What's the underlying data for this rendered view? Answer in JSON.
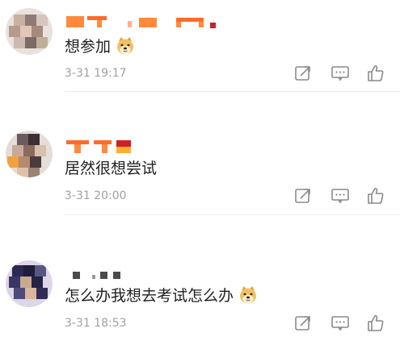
{
  "comments": [
    {
      "username": "",
      "text": "想参加",
      "emoji": "doge-emoji",
      "timestamp": "3-31 19:17"
    },
    {
      "username": "",
      "text": "居然很想尝试",
      "emoji": "",
      "timestamp": "3-31 20:00"
    },
    {
      "username": "",
      "text": "怎么办我想去考试怎么办",
      "emoji": "doge-emoji",
      "timestamp": "3-31 18:53"
    }
  ],
  "actions": {
    "repost_icon": "repost-icon",
    "comment_icon": "comment-icon",
    "like_icon": "thumbs-up-icon"
  },
  "colors": {
    "username_orange": "#ff8a3d",
    "username_red": "#d21f26",
    "timestamp_gray": "#a0a0a0",
    "icon_gray": "#8a8a8a",
    "divider": "#ececec"
  }
}
